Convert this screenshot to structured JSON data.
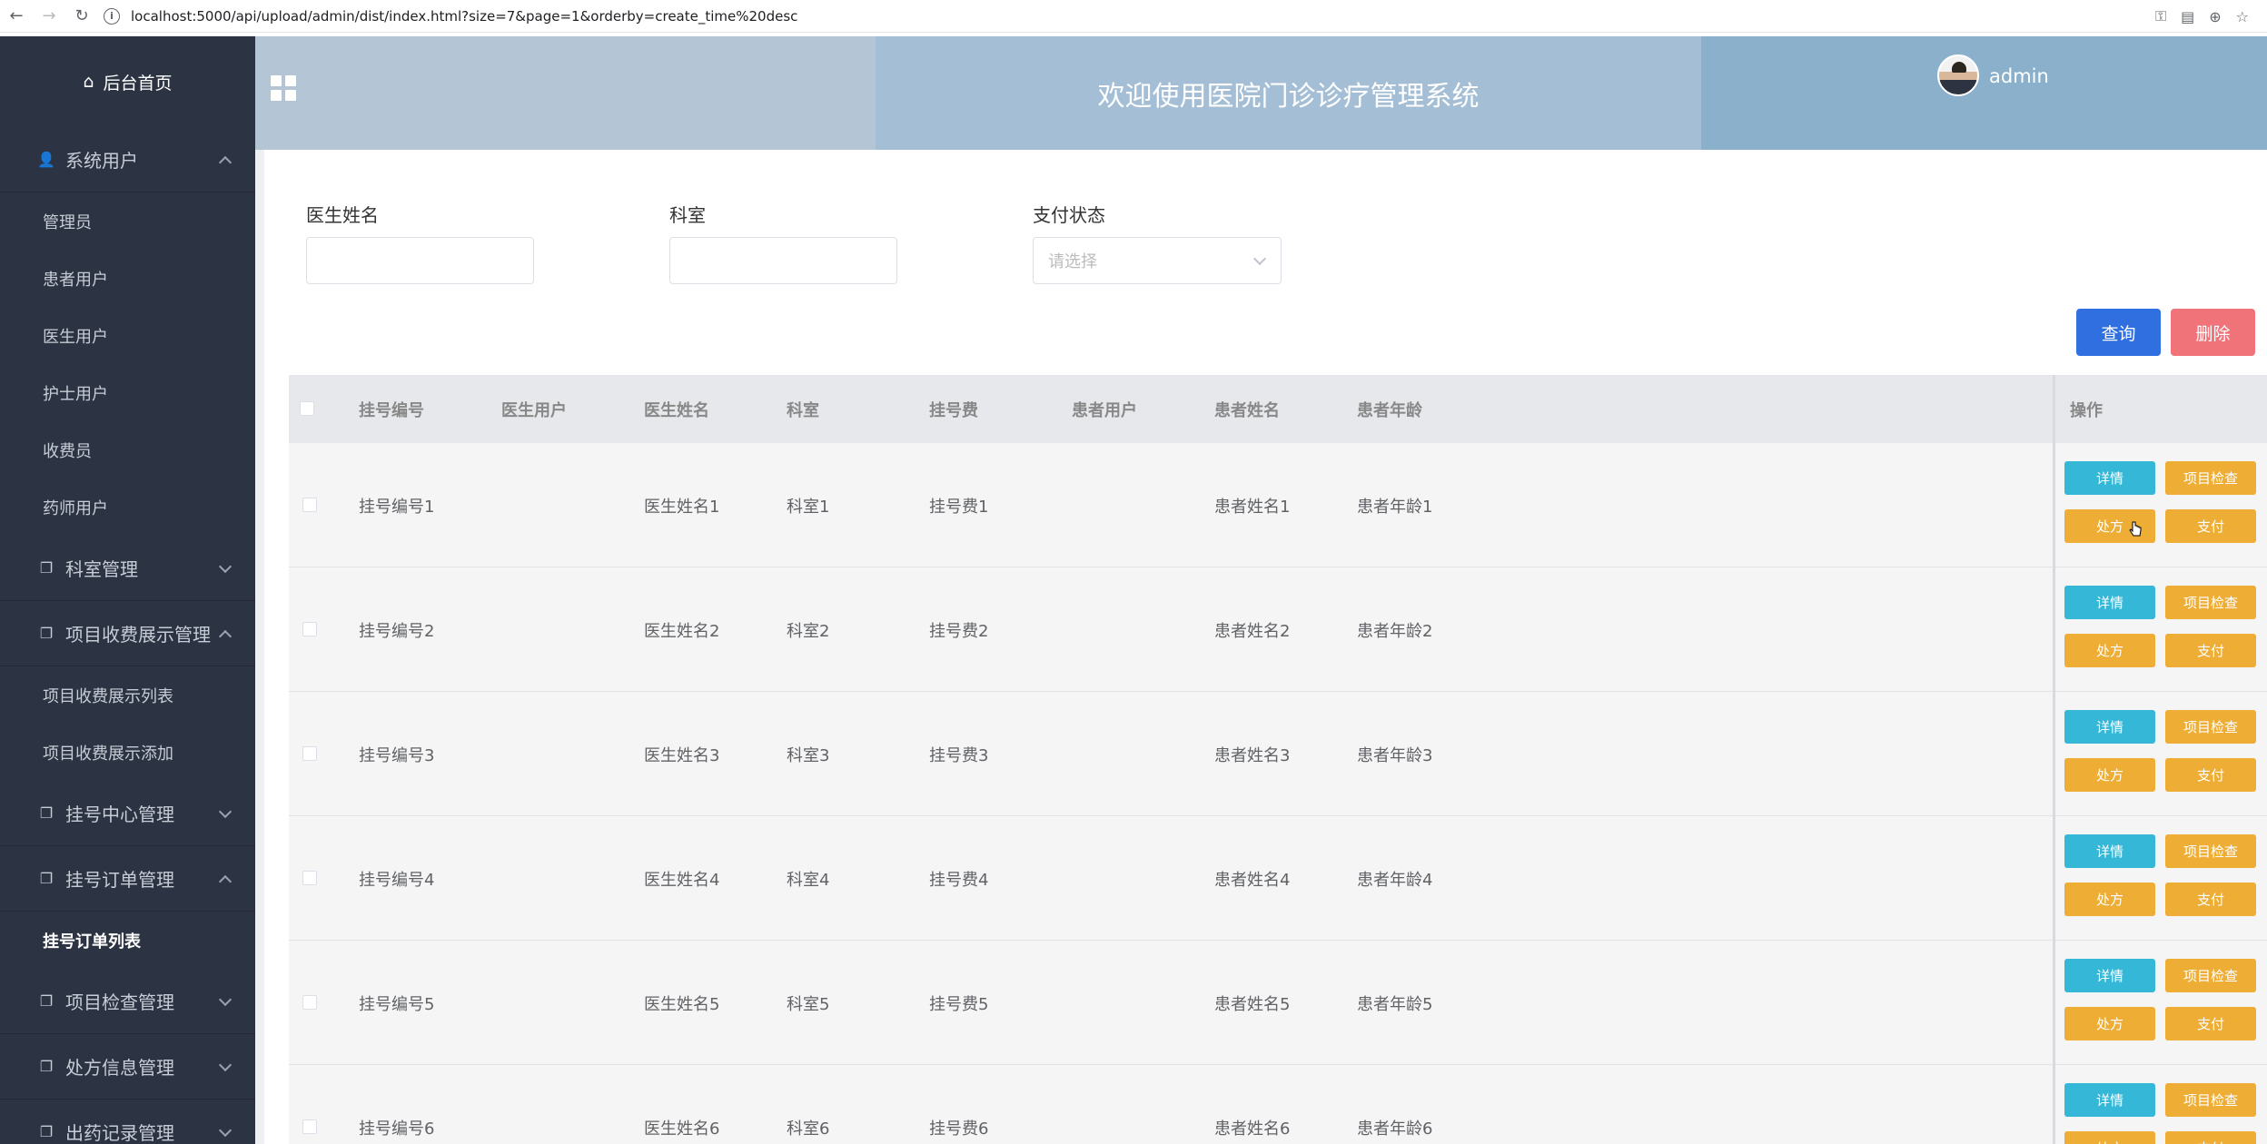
{
  "browser": {
    "url": "localhost:5000/api/upload/admin/dist/index.html?size=7&page=1&orderby=create_time%20desc"
  },
  "sidebar": {
    "home_label": "后台首页",
    "groups": [
      {
        "label": "系统用户",
        "expanded": true,
        "items": [
          "管理员",
          "患者用户",
          "医生用户",
          "护士用户",
          "收费员",
          "药师用户"
        ]
      },
      {
        "label": "科室管理",
        "expanded": false,
        "items": []
      },
      {
        "label": "项目收费展示管理",
        "expanded": true,
        "items": [
          "项目收费展示列表",
          "项目收费展示添加"
        ]
      },
      {
        "label": "挂号中心管理",
        "expanded": false,
        "items": []
      },
      {
        "label": "挂号订单管理",
        "expanded": true,
        "items": [
          "挂号订单列表"
        ],
        "active_item": "挂号订单列表"
      },
      {
        "label": "项目检查管理",
        "expanded": false,
        "items": []
      },
      {
        "label": "处方信息管理",
        "expanded": false,
        "items": []
      },
      {
        "label": "出药记录管理",
        "expanded": false,
        "items": []
      }
    ]
  },
  "header": {
    "title": "欢迎使用医院门诊诊疗管理系统",
    "username": "admin"
  },
  "filters": {
    "doctor_name_label": "医生姓名",
    "doctor_name_value": "",
    "department_label": "科室",
    "department_value": "",
    "pay_status_label": "支付状态",
    "pay_status_placeholder": "请选择"
  },
  "actions": {
    "query": "查询",
    "delete": "删除"
  },
  "table": {
    "columns": [
      "挂号编号",
      "医生用户",
      "医生姓名",
      "科室",
      "挂号费",
      "患者用户",
      "患者姓名",
      "患者年龄",
      "操作"
    ],
    "rows": [
      {
        "reg_no": "挂号编号1",
        "doctor_user": "",
        "doctor_name": "医生姓名1",
        "department": "科室1",
        "fee": "挂号费1",
        "patient_user": "",
        "patient_name": "患者姓名1",
        "patient_age": "患者年龄1"
      },
      {
        "reg_no": "挂号编号2",
        "doctor_user": "",
        "doctor_name": "医生姓名2",
        "department": "科室2",
        "fee": "挂号费2",
        "patient_user": "",
        "patient_name": "患者姓名2",
        "patient_age": "患者年龄2"
      },
      {
        "reg_no": "挂号编号3",
        "doctor_user": "",
        "doctor_name": "医生姓名3",
        "department": "科室3",
        "fee": "挂号费3",
        "patient_user": "",
        "patient_name": "患者姓名3",
        "patient_age": "患者年龄3"
      },
      {
        "reg_no": "挂号编号4",
        "doctor_user": "",
        "doctor_name": "医生姓名4",
        "department": "科室4",
        "fee": "挂号费4",
        "patient_user": "",
        "patient_name": "患者姓名4",
        "patient_age": "患者年龄4"
      },
      {
        "reg_no": "挂号编号5",
        "doctor_user": "",
        "doctor_name": "医生姓名5",
        "department": "科室5",
        "fee": "挂号费5",
        "patient_user": "",
        "patient_name": "患者姓名5",
        "patient_age": "患者年龄5"
      },
      {
        "reg_no": "挂号编号6",
        "doctor_user": "",
        "doctor_name": "医生姓名6",
        "department": "科室6",
        "fee": "挂号费6",
        "patient_user": "",
        "patient_name": "患者姓名6",
        "patient_age": "患者年龄6"
      }
    ],
    "row_actions": {
      "detail": "详情",
      "check": "项目检查",
      "prescription": "处方",
      "pay": "支付"
    }
  },
  "colors": {
    "sidebar_bg": "#2c3443",
    "query_button": "#2f6fe0",
    "delete_button": "#f0737a",
    "detail_button": "#35b7d8",
    "action_button": "#eead35"
  }
}
